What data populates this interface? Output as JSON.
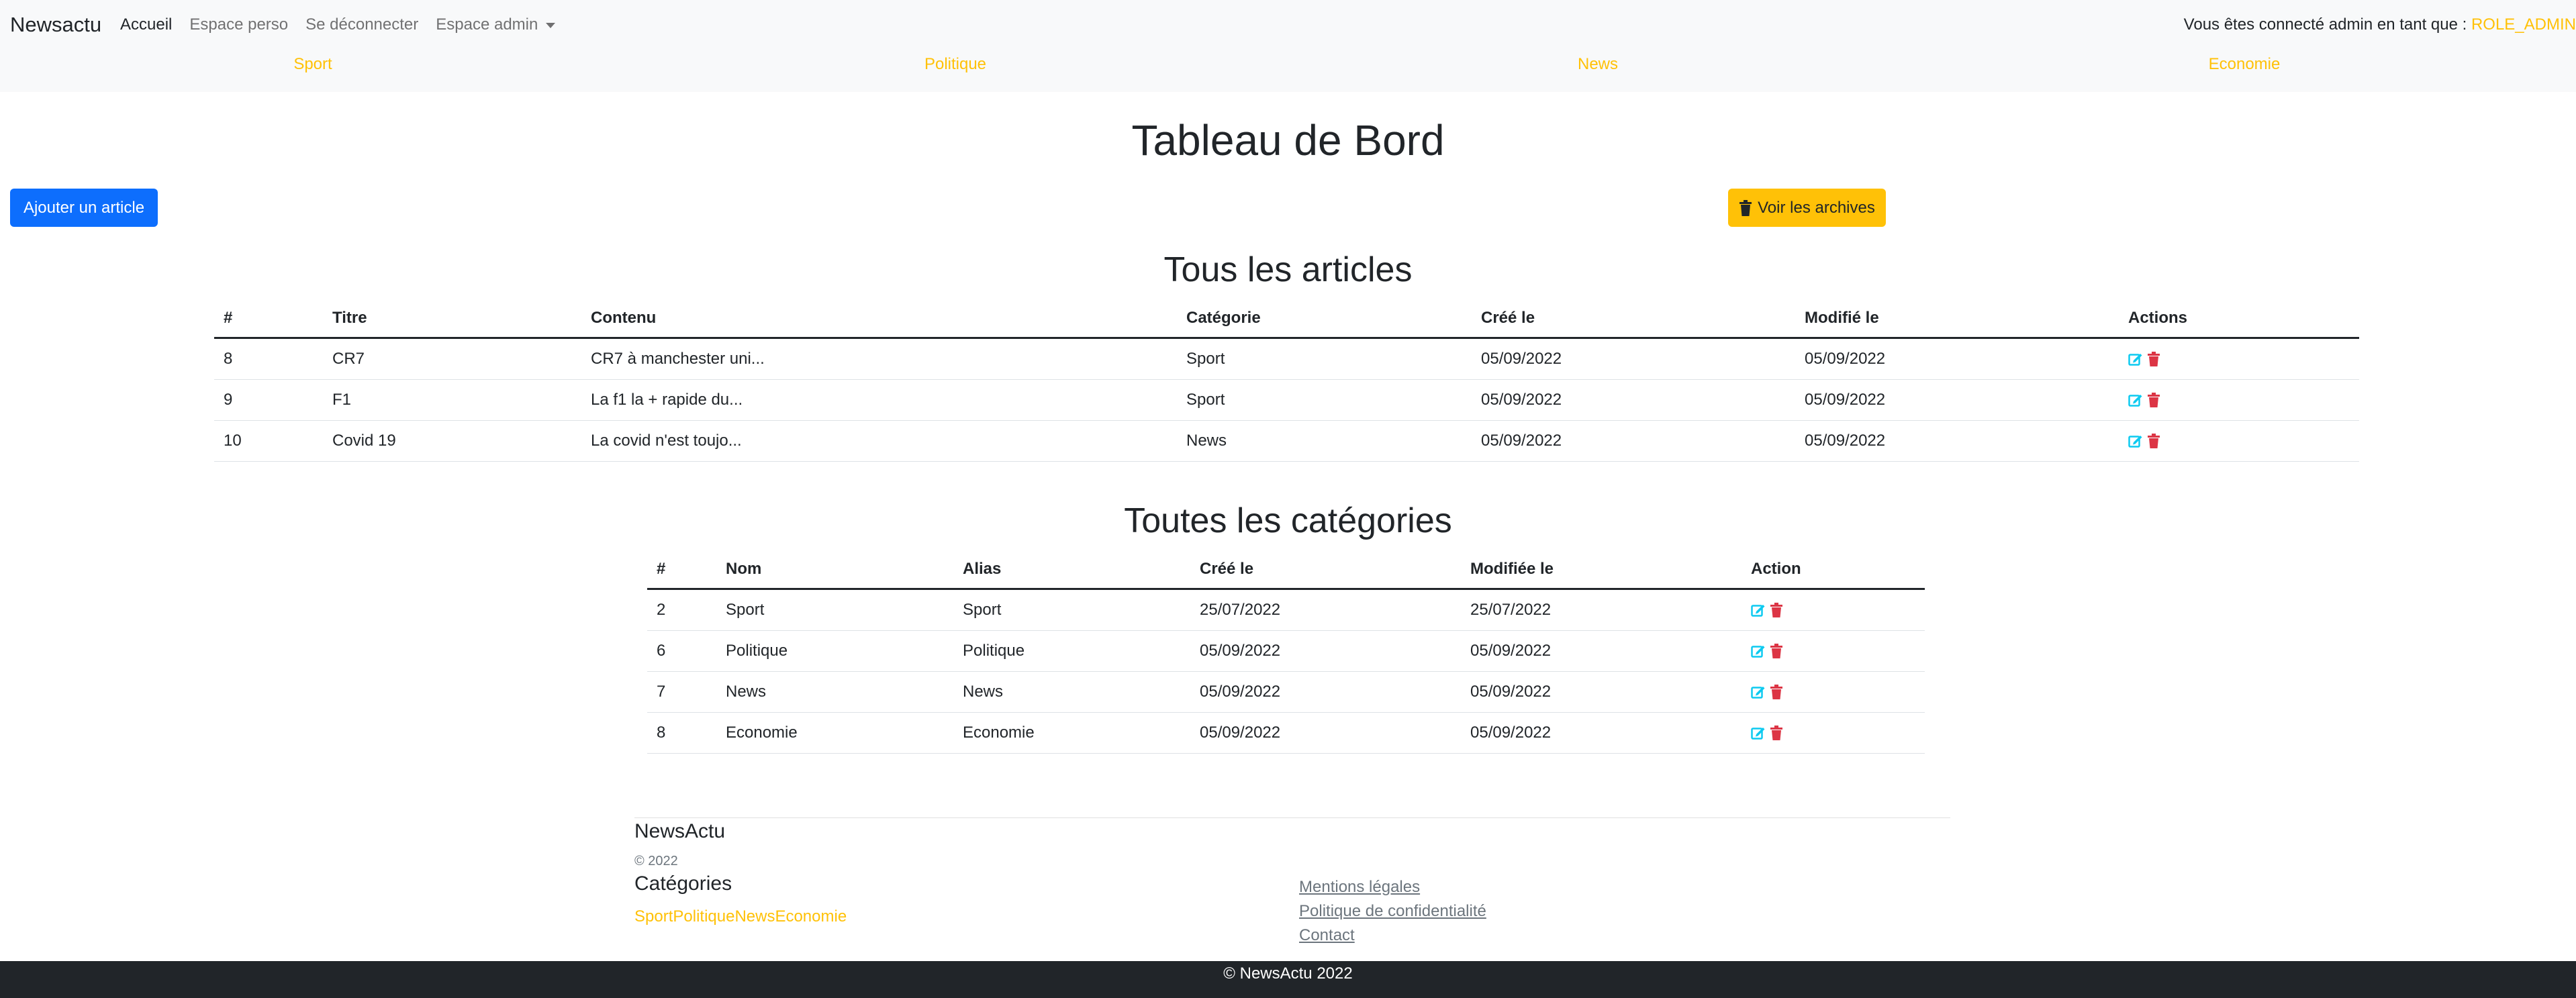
{
  "nav": {
    "brand": "Newsactu",
    "links": [
      "Accueil",
      "Espace perso",
      "Se déconnecter",
      "Espace admin"
    ],
    "connected_text": "Vous êtes connecté admin en tant que : ",
    "role": "ROLE_ADMIN"
  },
  "category_bar": [
    "Sport",
    "Politique",
    "News",
    "Economie"
  ],
  "page_title": "Tableau de Bord",
  "buttons": {
    "add_article": "Ajouter un article",
    "archives": "Voir les archives"
  },
  "articles": {
    "title": "Tous les articles",
    "headers": [
      "#",
      "Titre",
      "Contenu",
      "Catégorie",
      "Créé le",
      "Modifié le",
      "Actions"
    ],
    "rows": [
      [
        "8",
        "CR7",
        "CR7 à manchester uni...",
        "Sport",
        "05/09/2022",
        "05/09/2022"
      ],
      [
        "9",
        "F1",
        "La f1 la + rapide du...",
        "Sport",
        "05/09/2022",
        "05/09/2022"
      ],
      [
        "10",
        "Covid 19",
        "La covid n'est toujo...",
        "News",
        "05/09/2022",
        "05/09/2022"
      ]
    ]
  },
  "categories": {
    "title": "Toutes les catégories",
    "headers": [
      "#",
      "Nom",
      "Alias",
      "Créé le",
      "Modifiée le",
      "Action"
    ],
    "rows": [
      [
        "2",
        "Sport",
        "Sport",
        "25/07/2022",
        "25/07/2022"
      ],
      [
        "6",
        "Politique",
        "Politique",
        "05/09/2022",
        "05/09/2022"
      ],
      [
        "7",
        "News",
        "News",
        "05/09/2022",
        "05/09/2022"
      ],
      [
        "8",
        "Economie",
        "Economie",
        "05/09/2022",
        "05/09/2022"
      ]
    ]
  },
  "footer": {
    "brand": "NewsActu",
    "copyright": "© 2022",
    "categories_title": "Catégories",
    "categories": [
      "Sport",
      "Politique",
      "News",
      "Economie"
    ],
    "links": [
      "Mentions légales",
      "Politique de confidentialité",
      "Contact"
    ],
    "bottom": "© NewsActu 2022"
  },
  "colors": {
    "primary": "#0d6efd",
    "warning": "#ffc107",
    "edit": "#0dcaf0",
    "delete": "#dc3545",
    "dark": "#212529"
  },
  "icons": {
    "edit": "edit-icon",
    "delete": "trash-icon",
    "archive": "trash-icon",
    "dropdown": "caret-down-icon"
  }
}
